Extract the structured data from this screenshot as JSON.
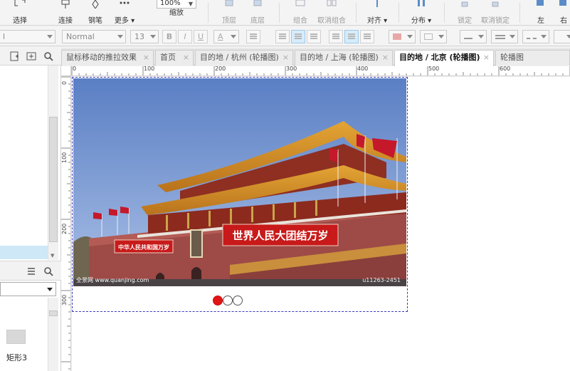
{
  "toolbar": {
    "zoom_value": "100%",
    "buttons": [
      {
        "label": "选择",
        "icon": "select-icon"
      },
      {
        "label": "连接",
        "icon": "connect-icon"
      },
      {
        "label": "钢笔",
        "icon": "pen-icon"
      },
      {
        "label": "更多 ▾",
        "icon": "more-icon"
      },
      {
        "label": "缩放",
        "icon": "zoom-icon"
      },
      {
        "label": "顶层",
        "icon": "bring-front-icon"
      },
      {
        "label": "底层",
        "icon": "send-back-icon"
      },
      {
        "label": "组合",
        "icon": "group-icon"
      },
      {
        "label": "取消组合",
        "icon": "ungroup-icon"
      },
      {
        "label": "对齐 ▾",
        "icon": "align-icon"
      },
      {
        "label": "分布 ▾",
        "icon": "distribute-icon"
      },
      {
        "label": "锁定",
        "icon": "lock-icon"
      },
      {
        "label": "取消锁定",
        "icon": "unlock-icon"
      },
      {
        "label": "左",
        "icon": "left-icon"
      },
      {
        "label": "右",
        "icon": "right-icon"
      }
    ]
  },
  "format_bar": {
    "font_family_partial": "l",
    "font_style": "Normal",
    "font_size": "13",
    "bold": "B",
    "italic": "I",
    "underline": "U",
    "font_color": "A"
  },
  "tabs": [
    {
      "label": "鼠标移动的推拉效果",
      "active": false
    },
    {
      "label": "首页",
      "active": false
    },
    {
      "label": "目的地 / 杭州 (轮播图)",
      "active": false
    },
    {
      "label": "目的地 / 上海 (轮播图)",
      "active": false
    },
    {
      "label": "目的地 / 北京 (轮播图)",
      "active": true
    },
    {
      "label": "轮播图",
      "active": false
    }
  ],
  "tab_close": "×",
  "ruler": {
    "h_labels": [
      "0",
      "100",
      "200",
      "300",
      "400",
      "500",
      "600"
    ],
    "v_labels": [
      "0",
      "100",
      "200",
      "300"
    ]
  },
  "left_panel": {
    "widget_label": "矩形3"
  },
  "carousel": {
    "watermark_left": "全景网 www.quanjing.com",
    "watermark_right": "u11263-2451",
    "banner_big": "世界人民大团结万岁",
    "banner_small": "中华人民共和国万岁",
    "dots_total": 3,
    "active_dot": 1
  },
  "colors": {
    "accent": "#3b3bbf",
    "active_dot": "#e21414",
    "selected_row": "#cfe8f7"
  }
}
